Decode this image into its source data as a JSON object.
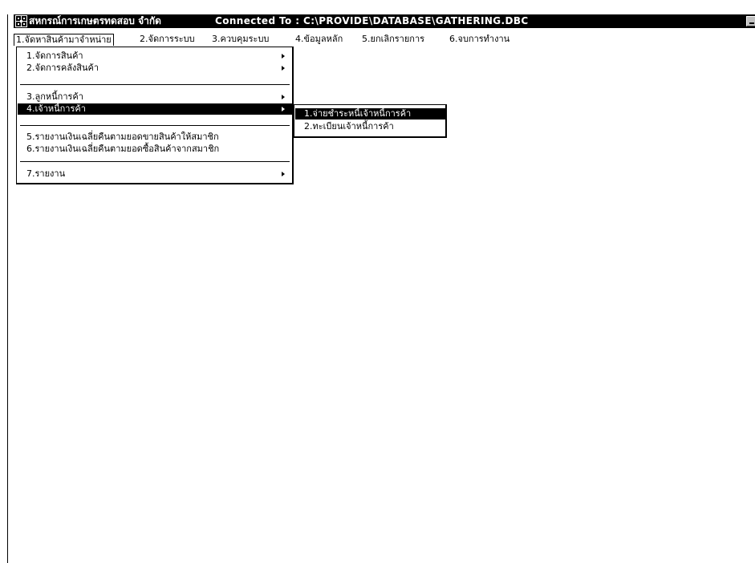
{
  "window": {
    "title": "สหกรณ์การเกษตรทดสอบ จำกัด",
    "connection": "Connected To : C:\\PROVIDE\\DATABASE\\GATHERING.DBC",
    "app_icon": "app-icon",
    "minimize_icon": "minimize-icon",
    "maximize_icon": "maximize-icon"
  },
  "menubar": {
    "items": [
      {
        "label": "1.จัดหาสินค้ามาจำหน่าย"
      },
      {
        "label": "2.จัดการระบบ"
      },
      {
        "label": "3.ควบคุมระบบ"
      },
      {
        "label": "4.ข้อมูลหลัก"
      },
      {
        "label": "5.ยกเลิกรายการ"
      },
      {
        "label": "6.จบการทำงาน"
      }
    ]
  },
  "dropdown": {
    "items": [
      {
        "label": "1.จัดการสินค้า",
        "has_submenu": true
      },
      {
        "label": "2.จัดการคลังสินค้า",
        "has_submenu": true
      },
      {
        "label": "3.ลูกหนี้การค้า",
        "has_submenu": true
      },
      {
        "label": "4.เจ้าหนี้การค้า",
        "has_submenu": true
      },
      {
        "label": "5.รายงานเงินเฉลี่ยคืนตามยอดขายสินค้าให้สมาชิก",
        "has_submenu": false
      },
      {
        "label": "6.รายงานเงินเฉลี่ยคืนตามยอดซื้อสินค้าจากสมาชิก",
        "has_submenu": false
      },
      {
        "label": "7.รายงาน",
        "has_submenu": true
      }
    ]
  },
  "submenu": {
    "items": [
      {
        "label": "1.จ่ายชำระหนี้เจ้าหนี้การค้า"
      },
      {
        "label": "2.ทะเบียนเจ้าหนี้การค้า"
      }
    ]
  },
  "colors": {
    "title_bar": "#000000",
    "title_text": "#ffffff",
    "highlight": "#000000",
    "background": "#ffffff"
  }
}
